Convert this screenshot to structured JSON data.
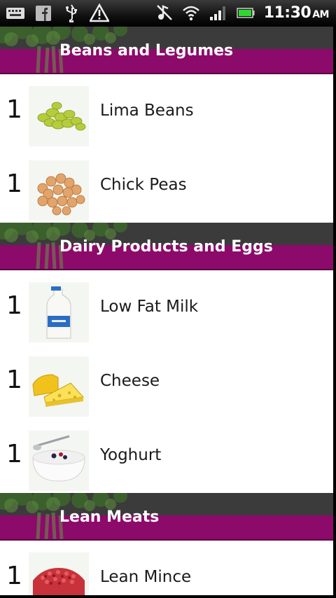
{
  "status_bar": {
    "time": "11:30",
    "ampm": "AM",
    "icons": [
      "keyboard-icon",
      "facebook-icon",
      "usb-icon",
      "warning-icon",
      "mute-icon",
      "wifi-icon",
      "signal-icon",
      "battery-icon"
    ]
  },
  "sections": [
    {
      "title": "Beans and Legumes",
      "items": [
        {
          "qty": "1",
          "name": "Lima Beans",
          "image": "lima-beans"
        },
        {
          "qty": "1",
          "name": "Chick Peas",
          "image": "chick-peas"
        }
      ]
    },
    {
      "title": "Dairy Products and Eggs",
      "items": [
        {
          "qty": "1",
          "name": "Low Fat Milk",
          "image": "milk"
        },
        {
          "qty": "1",
          "name": "Cheese",
          "image": "cheese"
        },
        {
          "qty": "1",
          "name": "Yoghurt",
          "image": "yoghurt"
        }
      ]
    },
    {
      "title": "Lean Meats",
      "items": [
        {
          "qty": "1",
          "name": "Lean Mince",
          "image": "mince"
        }
      ]
    }
  ],
  "colors": {
    "header_dark": "#3b3b3b",
    "header_magenta": "#8c0a6a",
    "row_bg": "#ffffff"
  }
}
